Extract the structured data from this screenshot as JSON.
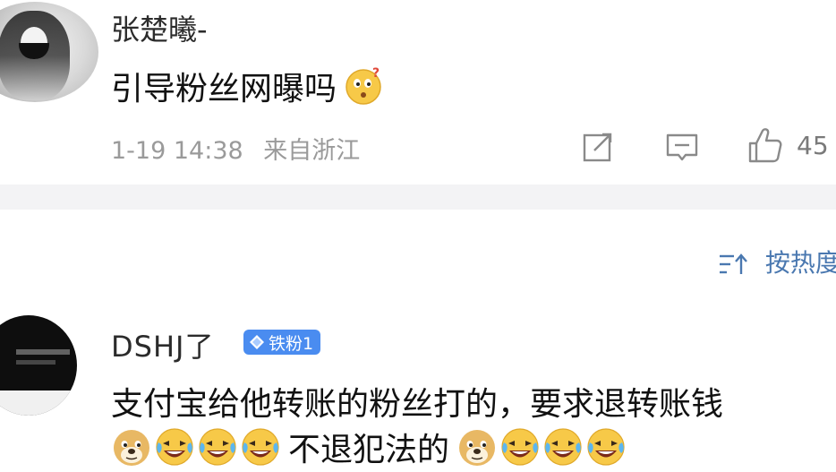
{
  "comment1": {
    "username": "张楚曦-",
    "text": "引导粉丝网曝吗",
    "emoji": "confused-face",
    "time": "1-19 14:38",
    "location": "来自浙江",
    "like_count": "45"
  },
  "sort": {
    "label": "按热度"
  },
  "comment2": {
    "username": "DSHJ了",
    "badge": "铁粉1",
    "text": "支付宝给他转账的粉丝打的，要求退转账钱",
    "emoji_line_text": "不退犯法的",
    "emojis_before": [
      "doge",
      "laugh-cry",
      "laugh-cry",
      "laugh-cry"
    ],
    "emojis_after": [
      "doge",
      "laugh-cry",
      "laugh-cry",
      "laugh-cry"
    ]
  },
  "colors": {
    "link_blue": "#4a78b0",
    "badge_blue": "#4a8cf0",
    "meta_gray": "#9a9a9a",
    "divider": "#f3f3f5"
  }
}
